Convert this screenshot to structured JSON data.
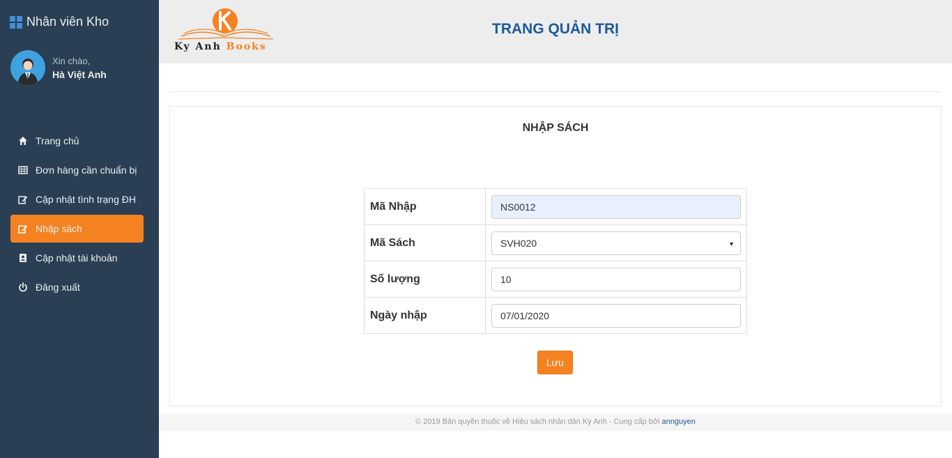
{
  "sidebar": {
    "brand": "Nhân viên Kho",
    "greeting": "Xin chào,",
    "username": "Hà Việt Anh",
    "items": [
      {
        "label": "Trang chủ",
        "icon": "home-icon"
      },
      {
        "label": "Đơn hàng cần chuẩn bị",
        "icon": "table-icon"
      },
      {
        "label": "Cập nhật tình trạng ĐH",
        "icon": "edit-icon"
      },
      {
        "label": "Nhập sách",
        "icon": "edit-icon",
        "active": true
      },
      {
        "label": "Cập nhật tài khoản",
        "icon": "contact-book-icon"
      },
      {
        "label": "Đăng xuất",
        "icon": "power-icon"
      }
    ]
  },
  "header": {
    "logo_text_1": "Ky Anh",
    "logo_text_2": "Books",
    "title": "TRANG QUẢN TRỊ"
  },
  "form": {
    "title": "NHẬP SÁCH",
    "rows": [
      {
        "label": "Mã Nhập",
        "value": "NS0012"
      },
      {
        "label": "Mã Sách",
        "value": "SVH020"
      },
      {
        "label": "Số lượng",
        "value": "10"
      },
      {
        "label": "Ngày nhập",
        "value": "07/01/2020"
      }
    ],
    "save_label": "Lưu"
  },
  "footer": {
    "text": "© 2019 Bản quyền thuộc về Hiệu sách nhân dân Kỳ Anh - Cung cấp bởi ",
    "link": "annguyen"
  },
  "colors": {
    "sidebar": "#2a3f54",
    "accent": "#f58220",
    "title": "#1b5a9a"
  }
}
